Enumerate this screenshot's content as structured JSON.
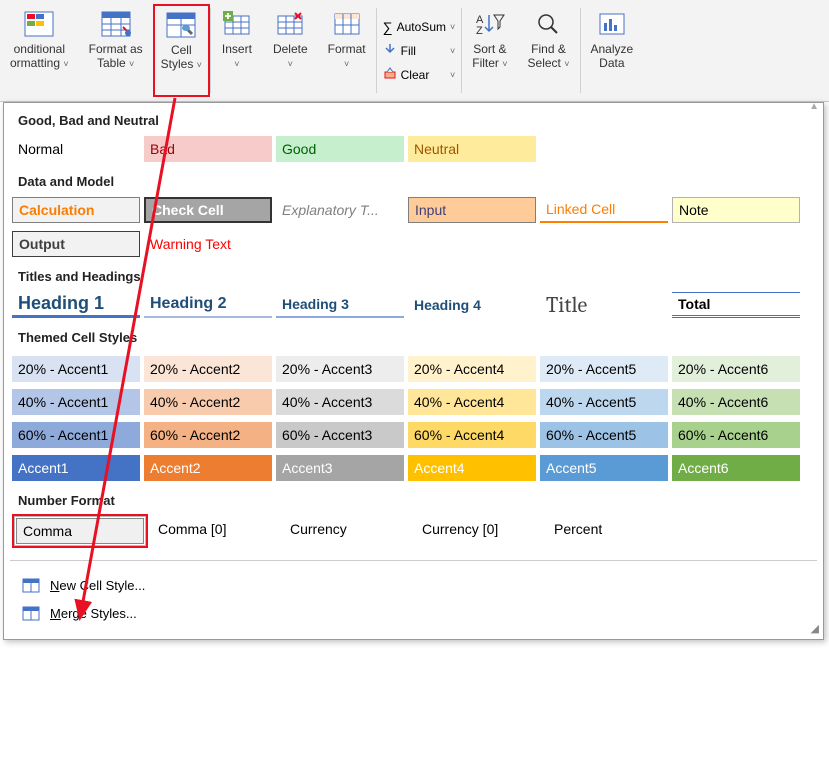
{
  "ribbon": {
    "conditional_formatting": "onditional\normatting",
    "format_as_table": "Format as\nTable",
    "cell_styles": "Cell\nStyles",
    "insert": "Insert",
    "delete": "Delete",
    "format": "Format",
    "autosum": "AutoSum",
    "fill": "Fill",
    "clear": "Clear",
    "sort_filter": "Sort &\nFilter",
    "find_select": "Find &\nSelect",
    "analyze_data": "Analyze\nData",
    "sigma": "∑"
  },
  "sections": {
    "good_bad_neutral": "Good, Bad and Neutral",
    "data_and_model": "Data and Model",
    "titles_and_headings": "Titles and Headings",
    "themed_cell_styles": "Themed Cell Styles",
    "number_format": "Number Format"
  },
  "styles": {
    "normal": "Normal",
    "bad": "Bad",
    "good": "Good",
    "neutral": "Neutral",
    "calculation": "Calculation",
    "check_cell": "Check Cell",
    "explanatory": "Explanatory T...",
    "input": "Input",
    "linked_cell": "Linked Cell",
    "note": "Note",
    "output": "Output",
    "warning_text": "Warning Text",
    "heading1": "Heading 1",
    "heading2": "Heading 2",
    "heading3": "Heading 3",
    "heading4": "Heading 4",
    "title": "Title",
    "total": "Total"
  },
  "themed": {
    "p20": [
      "20% - Accent1",
      "20% - Accent2",
      "20% - Accent3",
      "20% - Accent4",
      "20% - Accent5",
      "20% - Accent6"
    ],
    "p40": [
      "40% - Accent1",
      "40% - Accent2",
      "40% - Accent3",
      "40% - Accent4",
      "40% - Accent5",
      "40% - Accent6"
    ],
    "p60": [
      "60% - Accent1",
      "60% - Accent2",
      "60% - Accent3",
      "60% - Accent4",
      "60% - Accent5",
      "60% - Accent6"
    ],
    "acc": [
      "Accent1",
      "Accent2",
      "Accent3",
      "Accent4",
      "Accent5",
      "Accent6"
    ]
  },
  "themed_colors": {
    "p20": [
      "#d9e2f3",
      "#fbe5d6",
      "#ededed",
      "#fff2cc",
      "#deebf7",
      "#e2efda"
    ],
    "p40": [
      "#b4c6e7",
      "#f8cbad",
      "#dbdbdb",
      "#ffe699",
      "#bdd7ee",
      "#c6e0b4"
    ],
    "p60": [
      "#8eaadb",
      "#f4b183",
      "#c9c9c9",
      "#ffd966",
      "#9cc3e6",
      "#a9d18e"
    ],
    "acc": [
      "#4472c4",
      "#ed7d31",
      "#a5a5a5",
      "#ffc000",
      "#5b9bd5",
      "#70ad47"
    ]
  },
  "number_format": {
    "comma": "Comma",
    "comma0": "Comma [0]",
    "currency": "Currency",
    "currency0": "Currency [0]",
    "percent": "Percent"
  },
  "menu": {
    "new_cell_style": "New Cell Style...",
    "merge_styles": "Merge Styles..."
  }
}
